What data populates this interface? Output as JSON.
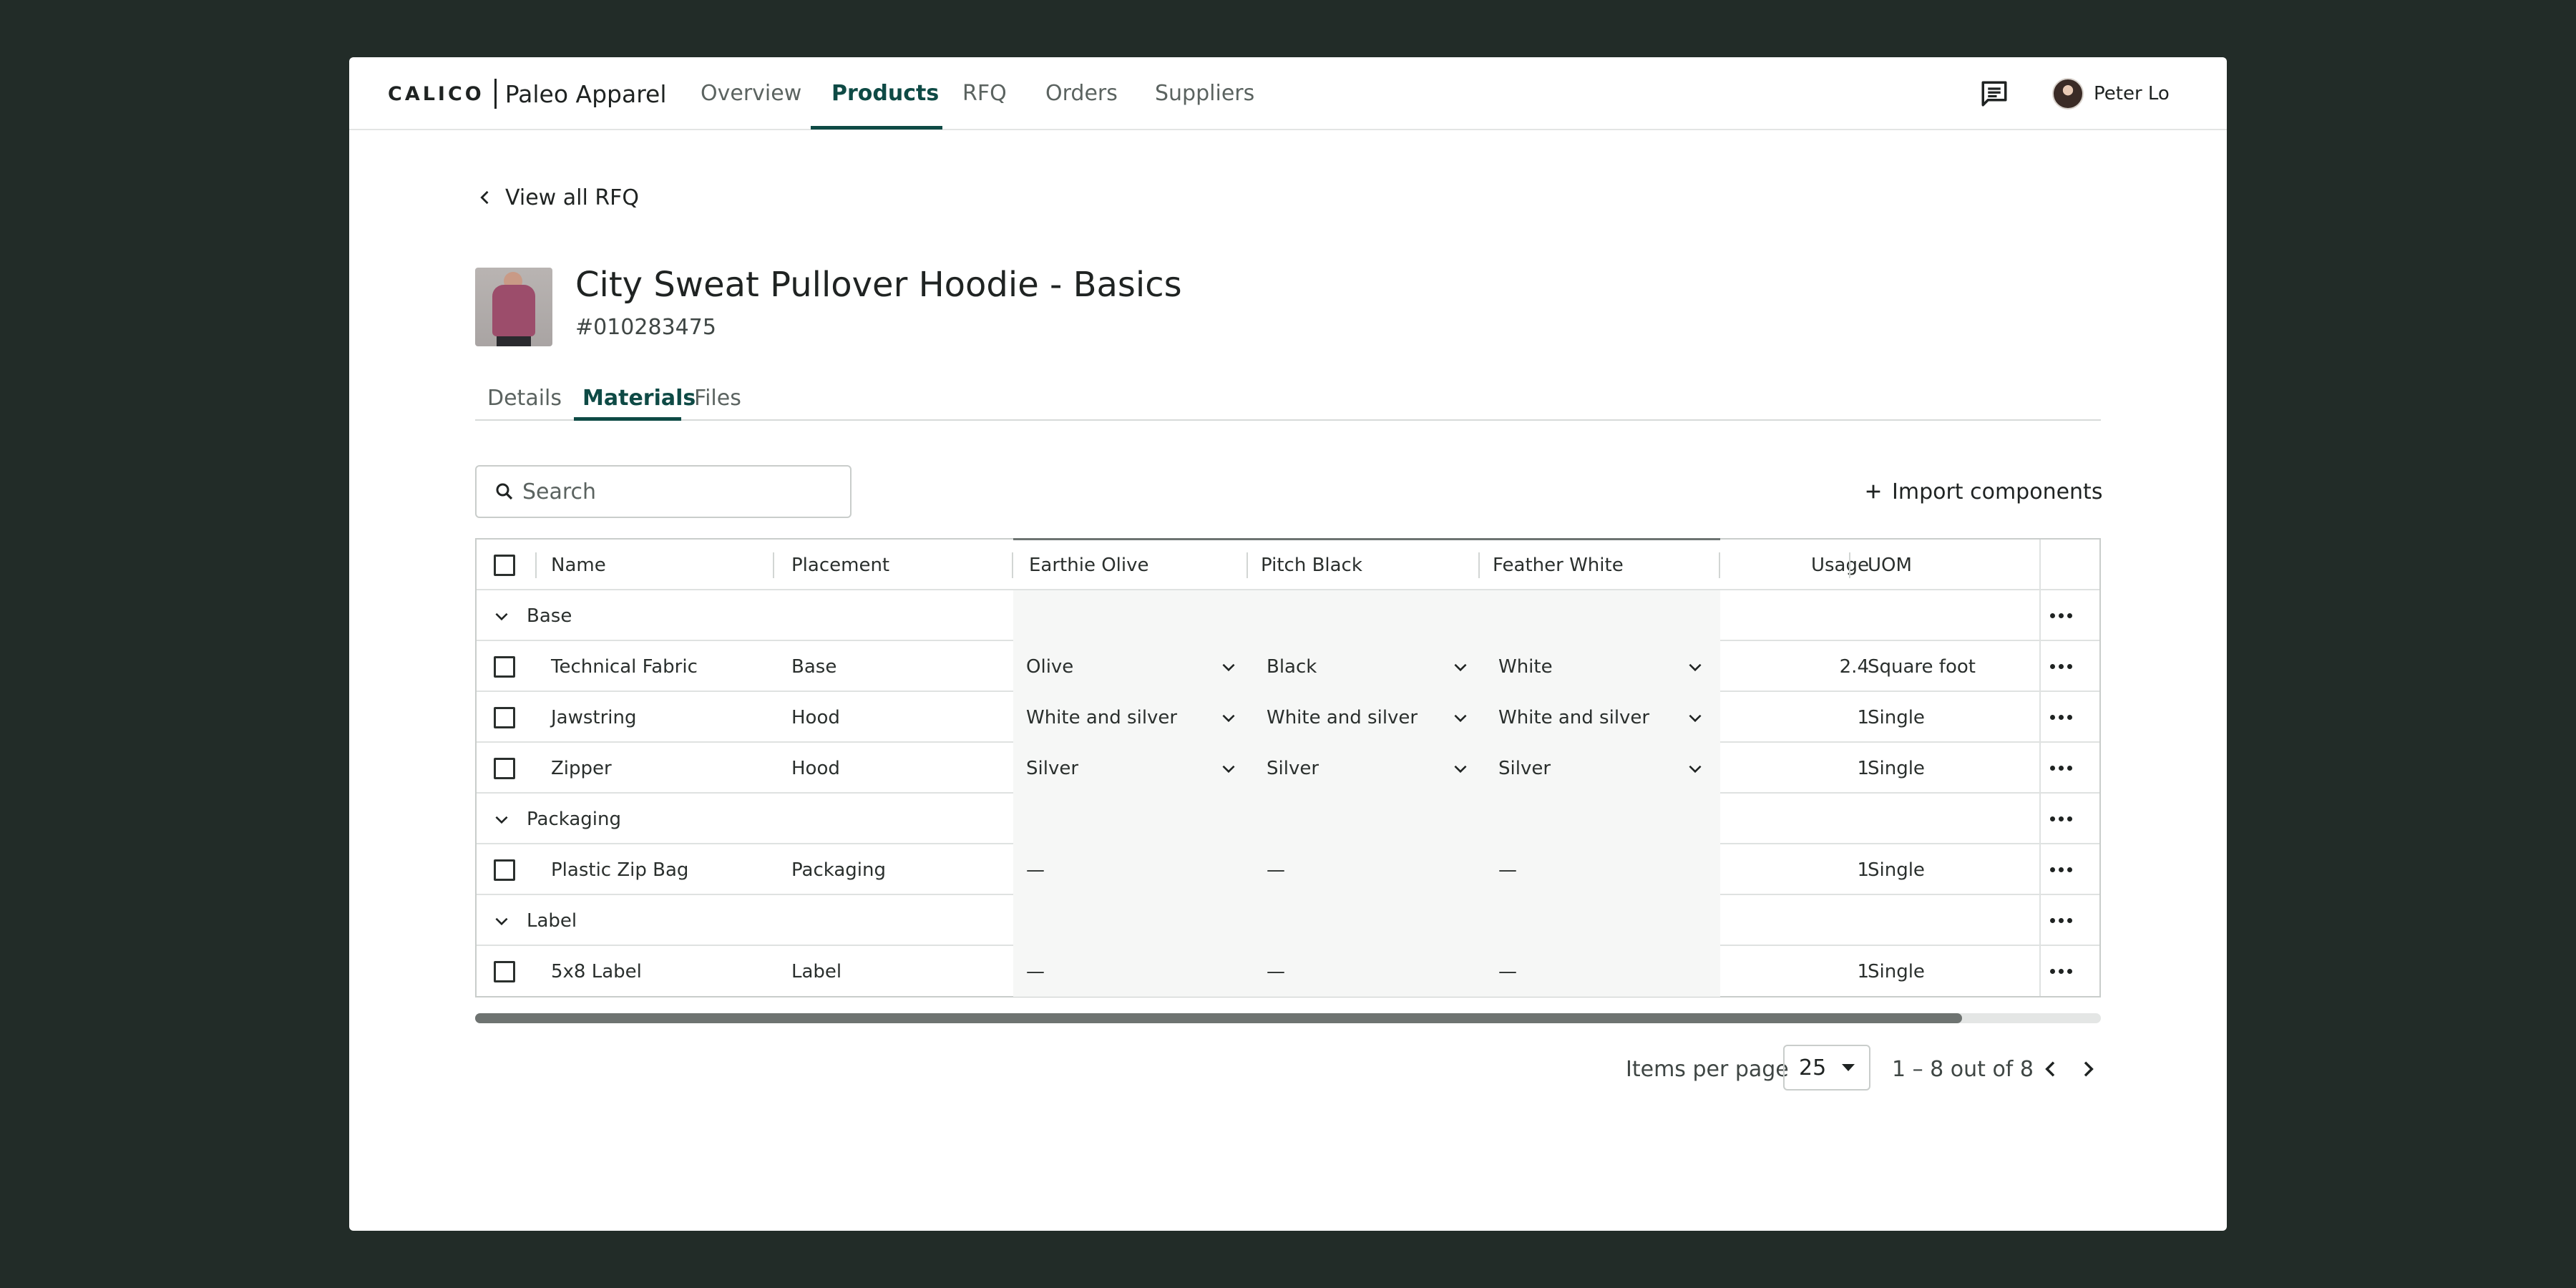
{
  "nav": {
    "brand": "CALICO",
    "company": "Paleo Apparel",
    "items": [
      {
        "label": "Overview"
      },
      {
        "label": "Products"
      },
      {
        "label": "RFQ"
      },
      {
        "label": "Orders"
      },
      {
        "label": "Suppliers"
      }
    ],
    "active": "Products",
    "user_name": "Peter Lo"
  },
  "back_link": "View all RFQ",
  "product": {
    "title": "City Sweat Pullover Hoodie - Basics",
    "sku": "#010283475"
  },
  "tabs": [
    {
      "label": "Details"
    },
    {
      "label": "Materials"
    },
    {
      "label": "Files"
    }
  ],
  "active_tab": "Materials",
  "search": {
    "placeholder": "Search",
    "value": ""
  },
  "import_label": "Import components",
  "table": {
    "columns": {
      "name": "Name",
      "placement": "Placement",
      "variant_1": "Earthie Olive",
      "variant_2": "Pitch Black",
      "variant_3": "Feather White",
      "usage": "Usage",
      "uom": "UOM"
    },
    "groups": [
      {
        "label": "Base",
        "rows": [
          {
            "name": "Technical Fabric",
            "placement": "Base",
            "v1": "Olive",
            "v2": "Black",
            "v3": "White",
            "usage": "2.4",
            "uom": "Square foot"
          },
          {
            "name": "Jawstring",
            "placement": "Hood",
            "v1": "White and silver",
            "v2": "White and silver",
            "v3": "White and silver",
            "usage": "1",
            "uom": "Single"
          },
          {
            "name": "Zipper",
            "placement": "Hood",
            "v1": "Silver",
            "v2": "Silver",
            "v3": "Silver",
            "usage": "1",
            "uom": "Single"
          }
        ]
      },
      {
        "label": "Packaging",
        "rows": [
          {
            "name": "Plastic Zip Bag",
            "placement": "Packaging",
            "v1": "—",
            "v2": "—",
            "v3": "—",
            "usage": "1",
            "uom": "Single"
          }
        ]
      },
      {
        "label": "Label",
        "rows": [
          {
            "name": "5x8 Label",
            "placement": "Label",
            "v1": "—",
            "v2": "—",
            "v3": "—",
            "usage": "1",
            "uom": "Single"
          }
        ]
      }
    ]
  },
  "pagination": {
    "items_per_page_label": "Items per page",
    "items_per_page": "25",
    "range": "1 – 8 out of 8"
  },
  "colors": {
    "accent": "#0e4a45",
    "background": "#222c28",
    "text": "#1f2322"
  }
}
